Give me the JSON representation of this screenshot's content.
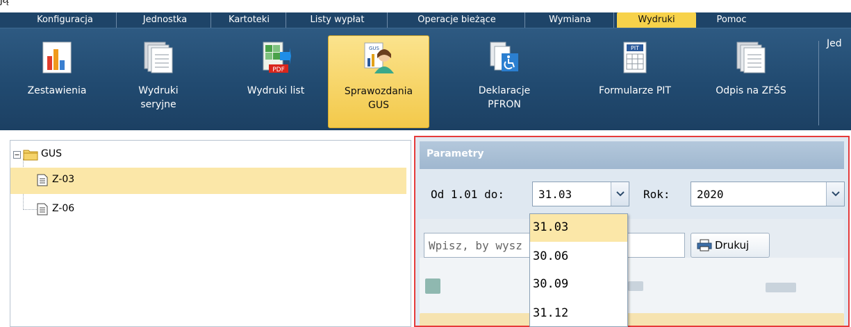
{
  "caption": {
    "text": "ją"
  },
  "menu": {
    "tabs": [
      {
        "label": "Konfiguracja"
      },
      {
        "label": "Jednostka"
      },
      {
        "label": "Kartoteki"
      },
      {
        "label": "Listy wypłat"
      },
      {
        "label": "Operacje bieżące"
      },
      {
        "label": "Wymiana"
      },
      {
        "label": "Wydruki",
        "active": true
      },
      {
        "label": "Pomoc"
      }
    ]
  },
  "ribbon": {
    "buttons": [
      {
        "label_line1": "Zestawienia",
        "label_line2": "",
        "icon": "bar-chart-icon"
      },
      {
        "label_line1": "Wydruki",
        "label_line2": "seryjne",
        "icon": "documents-icon"
      },
      {
        "label_line1": "Wydruki list",
        "label_line2": "",
        "icon": "pdf-export-icon"
      },
      {
        "label_line1": "Sprawozdania",
        "label_line2": "GUS",
        "icon": "gus-report-icon",
        "active": true
      },
      {
        "label_line1": "Deklaracje",
        "label_line2": "PFRON",
        "icon": "pfron-icon"
      },
      {
        "label_line1": "Formularze PIT",
        "label_line2": "",
        "icon": "pit-form-icon"
      },
      {
        "label_line1": "Odpis na ZFŚS",
        "label_line2": "",
        "icon": "documents-icon"
      }
    ],
    "edge_text": "Jed"
  },
  "tree": {
    "root": "GUS",
    "children": [
      {
        "label": "Z-03",
        "selected": true
      },
      {
        "label": "Z-06"
      }
    ]
  },
  "params": {
    "header": "Parametry",
    "od_label": "Od 1.01 do:",
    "od_value": "31.03",
    "rok_label": "Rok:",
    "rok_value": "2020",
    "options": [
      "31.03",
      "30.06",
      "30.09",
      "31.12"
    ]
  },
  "grid": {
    "search_value": "Wpisz, by wysz",
    "print_label": "Drukuj"
  },
  "colors": {
    "menu_bg": "#1e4468",
    "accent": "#f7d24a",
    "highlight_border": "#e63a3a"
  }
}
